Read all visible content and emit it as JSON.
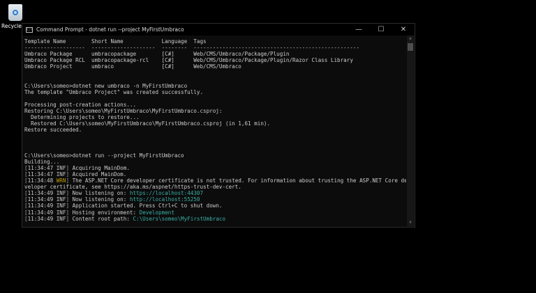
{
  "desktop": {
    "recycle_bin_label": "Recycle Bin"
  },
  "window": {
    "title": "Command Prompt - dotnet  run --project MyFirstUmbraco",
    "icon_text": "C:\\",
    "minimize": "—",
    "maximize": "☐",
    "close": "✕"
  },
  "console": {
    "lines": [
      [
        {
          "t": "Template Name        Short Name            Language  Tags"
        }
      ],
      [
        {
          "t": "-------------------  --------------------  --------  ----------------------------------------------------"
        }
      ],
      [
        {
          "t": "Umbraco Package      umbracopackage        [C#]      Web/CMS/Umbraco/Package/Plugin"
        }
      ],
      [
        {
          "t": "Umbraco Package RCL  umbracopackage-rcl    [C#]      Web/CMS/Umbraco/Package/Plugin/Razor Class Library"
        }
      ],
      [
        {
          "t": "Umbraco Project      umbraco               [C#]      Web/CMS/Umbraco"
        }
      ],
      [],
      [],
      [
        {
          "t": "C:\\Users\\someo>dotnet new umbraco -n MyFirstUmbraco"
        }
      ],
      [
        {
          "t": "The template \"Umbraco Project\" was created successfully."
        }
      ],
      [],
      [
        {
          "t": "Processing post-creation actions..."
        }
      ],
      [
        {
          "t": "Restoring C:\\Users\\someo\\MyFirstUmbraco\\MyFirstUmbraco.csproj:"
        }
      ],
      [
        {
          "t": "  Determining projects to restore..."
        }
      ],
      [
        {
          "t": "  Restored C:\\Users\\someo\\MyFirstUmbraco\\MyFirstUmbraco.csproj (in 1,61 min)."
        }
      ],
      [
        {
          "t": "Restore succeeded."
        }
      ],
      [],
      [],
      [],
      [
        {
          "t": "C:\\Users\\someo>dotnet run --project MyFirstUmbraco"
        }
      ],
      [
        {
          "t": "Building..."
        }
      ],
      [
        {
          "t": "[",
          "c": "gray"
        },
        {
          "t": "11:34:47 INF"
        },
        {
          "t": "]",
          "c": "gray"
        },
        {
          "t": " Acquiring MainDom."
        }
      ],
      [
        {
          "t": "[",
          "c": "gray"
        },
        {
          "t": "11:34:47 INF"
        },
        {
          "t": "]",
          "c": "gray"
        },
        {
          "t": " Acquired MainDom."
        }
      ],
      [
        {
          "t": "[",
          "c": "gray"
        },
        {
          "t": "11:34:48 "
        },
        {
          "t": "WRN",
          "c": "yellow"
        },
        {
          "t": "]",
          "c": "gray"
        },
        {
          "t": " The ASP.NET Core developer certificate is not trusted. For information about trusting the ASP.NET Core de"
        }
      ],
      [
        {
          "t": "veloper certificate, see https://aka.ms/aspnet/https-trust-dev-cert."
        }
      ],
      [
        {
          "t": "[",
          "c": "gray"
        },
        {
          "t": "11:34:49 INF"
        },
        {
          "t": "]",
          "c": "gray"
        },
        {
          "t": " Now listening on: "
        },
        {
          "t": "https://localhost:44307",
          "c": "teal"
        }
      ],
      [
        {
          "t": "[",
          "c": "gray"
        },
        {
          "t": "11:34:49 INF"
        },
        {
          "t": "]",
          "c": "gray"
        },
        {
          "t": " Now listening on: "
        },
        {
          "t": "http://localhost:55250",
          "c": "teal"
        }
      ],
      [
        {
          "t": "[",
          "c": "gray"
        },
        {
          "t": "11:34:49 INF"
        },
        {
          "t": "]",
          "c": "gray"
        },
        {
          "t": " Application started. Press Ctrl+C to shut down."
        }
      ],
      [
        {
          "t": "[",
          "c": "gray"
        },
        {
          "t": "11:34:49 INF"
        },
        {
          "t": "]",
          "c": "gray"
        },
        {
          "t": " Hosting environment: "
        },
        {
          "t": "Development",
          "c": "teal"
        }
      ],
      [
        {
          "t": "[",
          "c": "gray"
        },
        {
          "t": "11:34:49 INF"
        },
        {
          "t": "]",
          "c": "gray"
        },
        {
          "t": " Content root path: "
        },
        {
          "t": "C:\\Users\\someo\\MyFirstUmbraco",
          "c": "teal"
        }
      ]
    ]
  },
  "scrollbar": {
    "up": "▲",
    "down": "▼"
  }
}
